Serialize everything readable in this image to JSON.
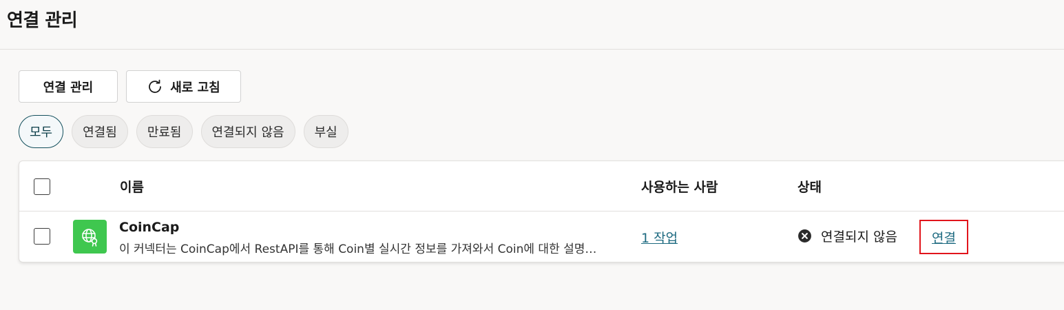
{
  "page": {
    "title": "연결 관리"
  },
  "toolbar": {
    "manage_label": "연결 관리",
    "refresh_label": "새로 고침",
    "refresh_icon": "refresh-icon"
  },
  "filters": [
    {
      "label": "모두",
      "active": true
    },
    {
      "label": "연결됨",
      "active": false
    },
    {
      "label": "만료됨",
      "active": false
    },
    {
      "label": "연결되지 않음",
      "active": false
    },
    {
      "label": "부실",
      "active": false
    }
  ],
  "table": {
    "columns": {
      "name": "이름",
      "users": "사용하는 사람",
      "status": "상태"
    },
    "rows": [
      {
        "icon": "globe-icon",
        "icon_color": "#3fc74f",
        "name": "CoinCap",
        "description": "이 커넥터는 CoinCap에서 RestAPI를 통해 Coin별 실시간 정보를 가져와서 Coin에 대한 설명…",
        "users": "1 작업",
        "status": "연결되지 않음",
        "status_icon": "close-circle-icon",
        "action": "연결"
      }
    ]
  },
  "colors": {
    "accent": "#1d6a80",
    "highlight_border": "#e1141b",
    "active_pill_border": "#134f5c"
  }
}
